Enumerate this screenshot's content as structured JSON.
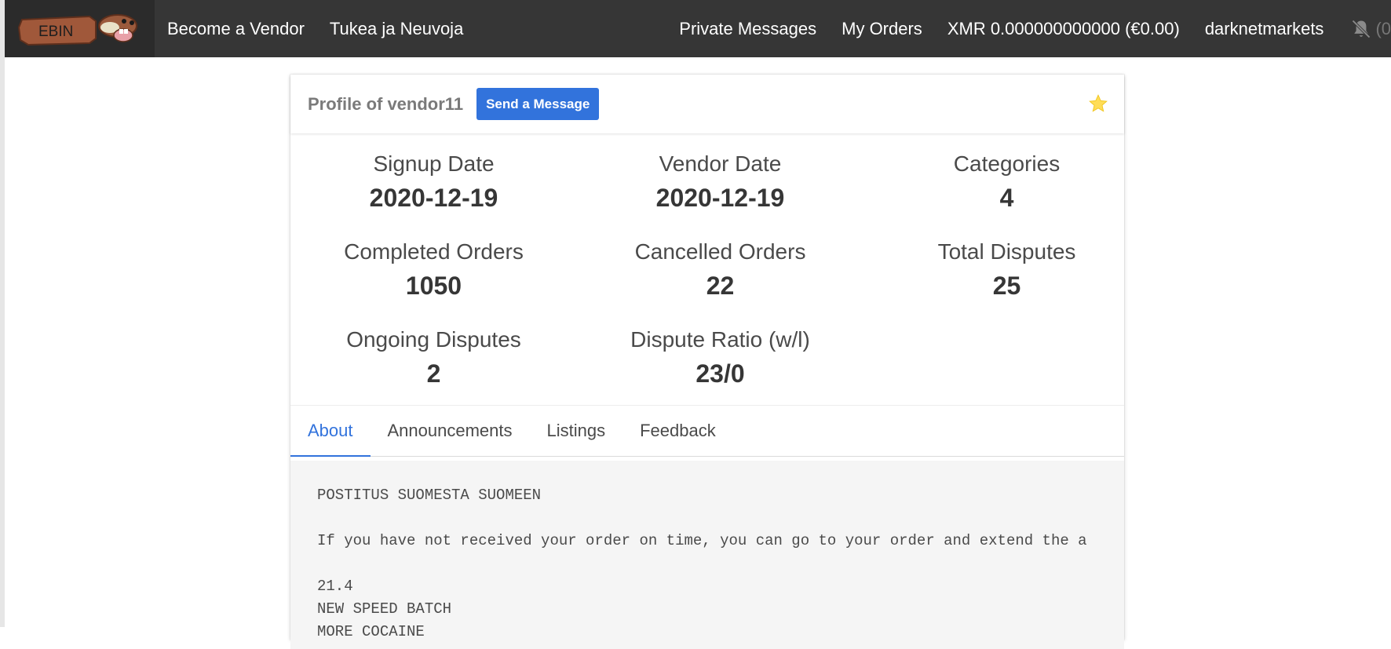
{
  "navbar": {
    "logo_text": "EBIN",
    "left_items": [
      "Become a Vendor",
      "Tukea ja Neuvoja"
    ],
    "right_items": [
      "Private Messages",
      "My Orders",
      "XMR 0.000000000000 (€0.00)",
      "darknetmarkets"
    ],
    "notif_count": "(0",
    "bell_icon": "bell-slash-icon"
  },
  "profile": {
    "title": "Profile of vendor11",
    "send_message_label": "Send a Message",
    "star_icon": "star-icon"
  },
  "stats": [
    {
      "label": "Signup Date",
      "value": "2020-12-19"
    },
    {
      "label": "Vendor Date",
      "value": "2020-12-19"
    },
    {
      "label": "Categories",
      "value": "4"
    },
    {
      "label": "Completed Orders",
      "value": "1050"
    },
    {
      "label": "Cancelled Orders",
      "value": "22"
    },
    {
      "label": "Total Disputes",
      "value": "25"
    },
    {
      "label": "Ongoing Disputes",
      "value": "2"
    },
    {
      "label": "Dispute Ratio (w/l)",
      "value": "23/0"
    }
  ],
  "tabs": [
    "About",
    "Announcements",
    "Listings",
    "Feedback"
  ],
  "about_text": "POSTITUS SUOMESTA SUOMEEN\n\nIf you have not received your order on time, you can go to your order and extend the a\n\n21.4\nNEW SPEED BATCH\nMORE COCAINE",
  "colors": {
    "navbar_bg": "#363636",
    "link_blue": "#3273dc",
    "star": "#ffdd57"
  }
}
